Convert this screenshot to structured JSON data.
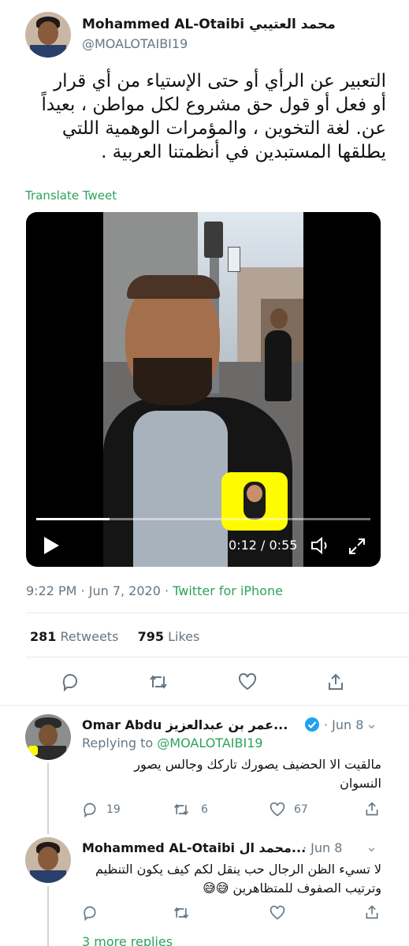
{
  "tweet": {
    "author_name": "Mohammed AL-Otaibi محمد العتيبي",
    "handle": "@MOALOTAIBI19",
    "text_lines": [
      "التعبير عن الرأي أو حتى الإستياء من أي قرار",
      "أو فعل أو قول حق مشروع لكل مواطن ، بعيداً",
      "عن. لغة التخوين ، والمؤمرات الوهمية اللتي",
      "يطلقها المستبدين في أنظمتنا العربية ."
    ],
    "translate_label": "Translate Tweet",
    "video": {
      "current_time": "0:12",
      "duration": "0:55",
      "time_display": "0:12 / 0:55",
      "progress_fraction": 0.22
    },
    "timestamp": "9:22 PM · Jun 7, 2020 · ",
    "client": "Twitter for iPhone",
    "retweets_count": "281",
    "retweets_label": "Retweets",
    "likes_count": "795",
    "likes_label": "Likes"
  },
  "icons": {
    "reply": "reply-icon",
    "retweet": "retweet-icon",
    "like": "heart-icon",
    "share": "share-icon",
    "verified": "verified-badge-icon",
    "play": "play-icon",
    "volume": "volume-icon",
    "fullscreen": "expand-icon",
    "more": "chevron-down-icon"
  },
  "colors": {
    "accent": "#2ca35a",
    "secondary_text": "#657786",
    "verified": "#1da1f2"
  },
  "replies": [
    {
      "author_name": "Omar Abdu عمر بن عبدالعزيز...",
      "date": "· Jun 8",
      "replying_prefix": "Replying to ",
      "replying_to": "@MOALOTAIBI19",
      "text_lines": [
        "مالقيت الا الحضيف يصورك تاركك وجالس يصور",
        "النسوان"
      ],
      "reply_count": "19",
      "retweet_count": "6",
      "like_count": "67"
    },
    {
      "author_name": "Mohammed AL-Otaibi محمد ال...",
      "date": "· Jun 8",
      "text_lines": [
        "لا تسيء الظن الرجال حب ينقل لكم كيف يكون التنظيم",
        "وترتيب الصفوف للمتظاهرين 😅😅"
      ]
    }
  ],
  "more_replies": "3 more replies"
}
